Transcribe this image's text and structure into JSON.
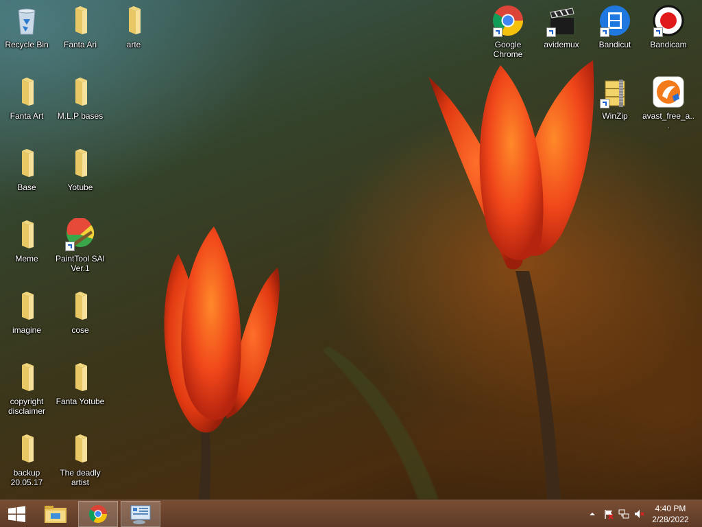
{
  "desktop": {
    "icons_left": [
      {
        "label": "Recycle Bin",
        "icon": "recycle-bin-icon"
      },
      {
        "label": "Fanta Ari",
        "icon": "folder-icon"
      },
      {
        "label": "arte",
        "icon": "folder-icon"
      },
      {
        "label": "Fanta Art",
        "icon": "folder-icon"
      },
      {
        "label": "M.L.P bases",
        "icon": "folder-icon"
      },
      {
        "label": "Base",
        "icon": "folder-icon"
      },
      {
        "label": "Yotube",
        "icon": "folder-icon"
      },
      {
        "label": "Meme",
        "icon": "folder-icon"
      },
      {
        "label": "PaintTool SAI Ver.1",
        "icon": "painttool-sai-icon"
      },
      {
        "label": "imagine",
        "icon": "folder-icon"
      },
      {
        "label": "cose",
        "icon": "folder-icon"
      },
      {
        "label": "copyright disclaimer",
        "icon": "folder-icon"
      },
      {
        "label": "Fanta Yotube",
        "icon": "folder-icon"
      },
      {
        "label": "backup 20.05.17",
        "icon": "folder-icon"
      },
      {
        "label": "The deadly artist",
        "icon": "folder-icon"
      }
    ],
    "icons_right": [
      {
        "label": "Google Chrome",
        "icon": "chrome-icon"
      },
      {
        "label": "avidemux",
        "icon": "clapperboard-icon"
      },
      {
        "label": "Bandicut",
        "icon": "film-icon"
      },
      {
        "label": "Bandicam",
        "icon": "record-icon"
      },
      {
        "label": "WinZip",
        "icon": "zip-icon"
      },
      {
        "label": "avast_free_a...",
        "icon": "avast-icon"
      }
    ]
  },
  "taskbar": {
    "start": "windows-logo-icon",
    "pinned": [
      "file-explorer-icon",
      "chrome-icon",
      "control-panel-icon"
    ],
    "tray": [
      "show-hidden-icons-icon",
      "action-center-flag-icon",
      "network-icon",
      "volume-muted-icon"
    ],
    "clock": {
      "time": "4:40 PM",
      "date": "2/28/2022"
    }
  }
}
